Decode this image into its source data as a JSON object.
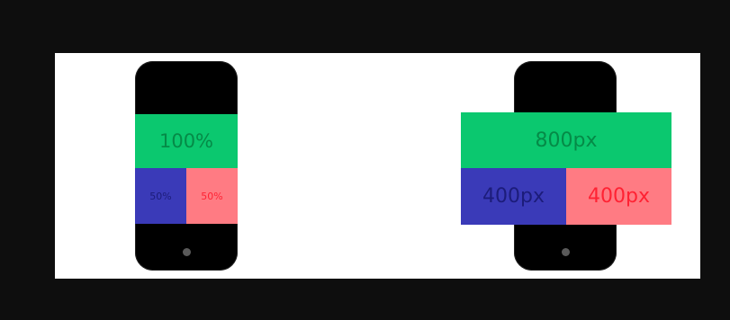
{
  "left_demo": {
    "top_label": "100%",
    "bottom_left_label": "50%",
    "bottom_right_label": "50%"
  },
  "right_demo": {
    "top_label": "800px",
    "bottom_left_label": "400px",
    "bottom_right_label": "400px"
  },
  "colors": {
    "background": "#0e0e0e",
    "panel": "#ffffff",
    "phone": "#000000",
    "green": "#0bc86f",
    "blue": "#3a3ab8",
    "red": "#ff7b83"
  }
}
